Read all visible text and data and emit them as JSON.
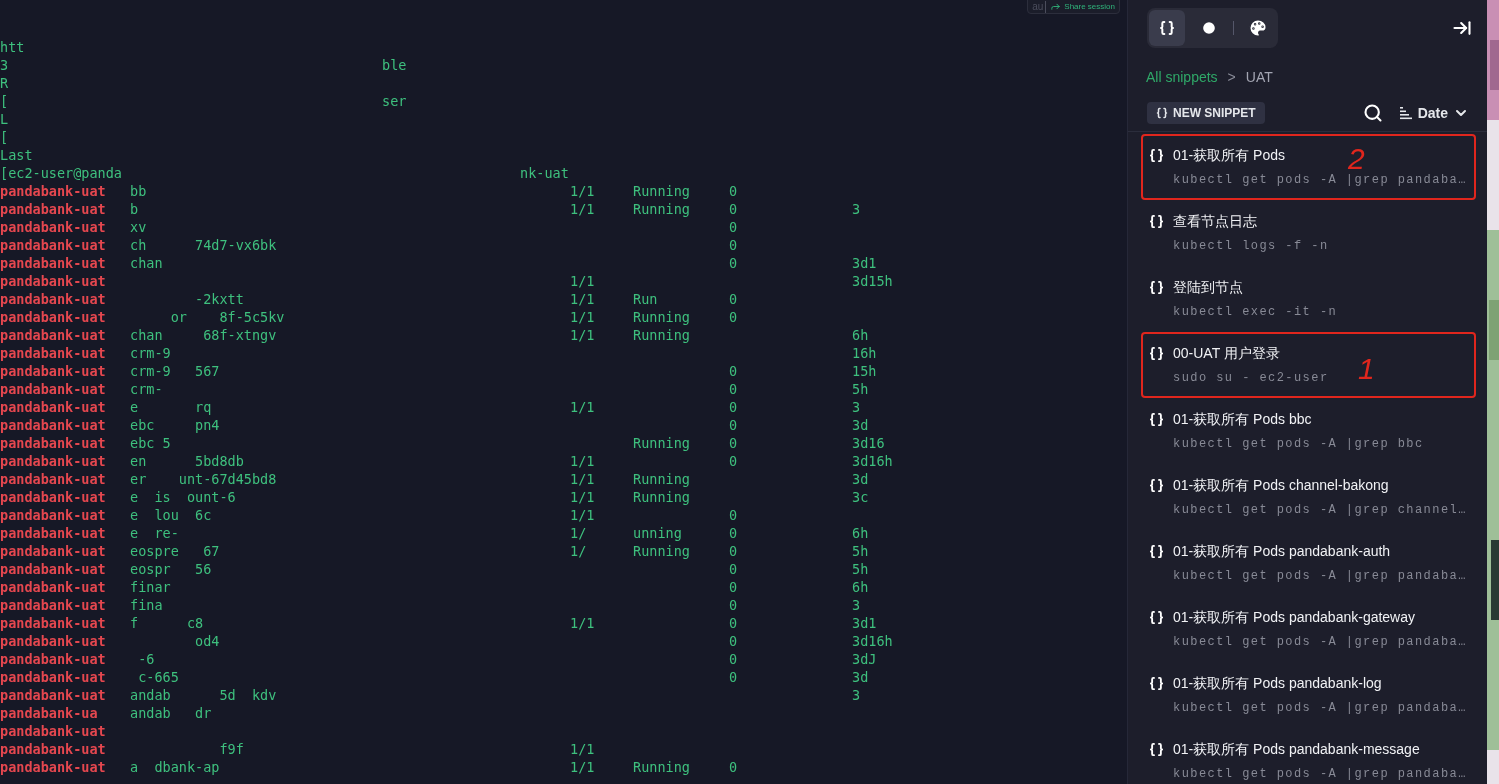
{
  "share_widget": {
    "label": "au",
    "button": "Share session"
  },
  "terminal": {
    "lines": [
      {
        "kind": "output",
        "text": "htt"
      },
      {
        "kind": "output",
        "text": "3",
        "tail": "ble"
      },
      {
        "kind": "output",
        "text": "R"
      },
      {
        "kind": "output",
        "text": "[",
        "tail": "ser"
      },
      {
        "kind": "output",
        "text": "L"
      },
      {
        "kind": "output",
        "text": "["
      },
      {
        "kind": "output",
        "text": "Last"
      },
      {
        "kind": "prompt",
        "text": "[ec2-user@panda",
        "tail": "nk-uat"
      }
    ],
    "rows": [
      {
        "namespace": "pandabank-uat",
        "name": "bb",
        "ready": "1/1",
        "status": "Running",
        "restarts": "0"
      },
      {
        "namespace": "pandabank-uat",
        "name": "b",
        "ready": "1/1",
        "status": "Running",
        "restarts": "0",
        "age": "3"
      },
      {
        "namespace": "pandabank-uat",
        "name": "xv",
        "restarts": "0"
      },
      {
        "namespace": "pandabank-uat",
        "name": "ch      74d7-vx6bk",
        "restarts": "0"
      },
      {
        "namespace": "pandabank-uat",
        "name": "chan",
        "restarts": "0",
        "age": "3d1"
      },
      {
        "namespace": "pandabank-uat",
        "ready": "1/1",
        "age": "3d15h"
      },
      {
        "namespace": "pandabank-uat",
        "name": "        -2kxtt",
        "ready": "1/1",
        "status": "Run",
        "restarts": "0"
      },
      {
        "namespace": "pandabank-uat",
        "name": "     or    8f-5c5kv",
        "ready": "1/1",
        "status": "Running",
        "restarts": "0"
      },
      {
        "namespace": "pandabank-uat",
        "name": "chan     68f-xtngv",
        "ready": "1/1",
        "status": "Running",
        "age": "6h"
      },
      {
        "namespace": "pandabank-uat",
        "name": "crm-9",
        "age": "16h"
      },
      {
        "namespace": "pandabank-uat",
        "name": "crm-9   567",
        "restarts": "0",
        "age": "15h"
      },
      {
        "namespace": "pandabank-uat",
        "name": "crm-",
        "restarts": "0",
        "age": "5h"
      },
      {
        "namespace": "pandabank-uat",
        "name": "e       rq",
        "ready": "1/1",
        "restarts": "0",
        "age": "3"
      },
      {
        "namespace": "pandabank-uat",
        "name": "ebc     pn4",
        "restarts": "0",
        "age": "3d"
      },
      {
        "namespace": "pandabank-uat",
        "name": "ebc 5",
        "status": "Running",
        "restarts": "0",
        "age": "3d16"
      },
      {
        "namespace": "pandabank-uat",
        "name": "en      5bd8db",
        "ready": "1/1",
        "restarts": "0",
        "age": "3d16h"
      },
      {
        "namespace": "pandabank-uat",
        "name": "er    unt-67d45bd8",
        "ready": "1/1",
        "status": "Running",
        "age": "3d"
      },
      {
        "namespace": "pandabank-uat",
        "name": "e  is  ount-6",
        "ready": "1/1",
        "status": "Running",
        "age": "3c"
      },
      {
        "namespace": "pandabank-uat",
        "name": "e  lou  6c",
        "ready": "1/1",
        "restarts": "0"
      },
      {
        "namespace": "pandabank-uat",
        "name": "e  re-",
        "ready": "1/",
        "status": "unning",
        "restarts": "0",
        "age": "6h"
      },
      {
        "namespace": "pandabank-uat",
        "name": "eospre   67",
        "ready": "1/",
        "status": "Running",
        "restarts": "0",
        "age": "5h"
      },
      {
        "namespace": "pandabank-uat",
        "name": "eospr   56",
        "restarts": "0",
        "age": "5h"
      },
      {
        "namespace": "pandabank-uat",
        "name": "finar",
        "restarts": "0",
        "age": "6h"
      },
      {
        "namespace": "pandabank-uat",
        "name": "fina",
        "restarts": "0",
        "age": "3"
      },
      {
        "namespace": "pandabank-uat",
        "name": "f      c8",
        "ready": "1/1",
        "restarts": "0",
        "age": "3d1"
      },
      {
        "namespace": "pandabank-uat",
        "name": "        od4",
        "restarts": "0",
        "age": "3d16h"
      },
      {
        "namespace": "pandabank-uat",
        "name": " -6",
        "restarts": "0",
        "age": "3dJ"
      },
      {
        "namespace": "pandabank-uat",
        "name": " c-665",
        "restarts": "0",
        "age": "3d"
      },
      {
        "namespace": "pandabank-uat",
        "name": "andab      5d  kdv",
        "age": "3"
      },
      {
        "namespace": "pandabank-ua",
        "name": "andab   dr"
      },
      {
        "namespace": "pandabank-uat"
      },
      {
        "namespace": "pandabank-uat",
        "name": "           f9f",
        "ready": "1/1"
      },
      {
        "namespace": "pandabank-uat",
        "name": "a  dbank-ap",
        "ready": "1/1",
        "status": "Running",
        "restarts": "0"
      }
    ]
  },
  "sidebar": {
    "tabs": [
      {
        "kind": "snippets",
        "selected": true
      },
      {
        "kind": "history",
        "selected": false
      },
      {
        "kind": "themes",
        "selected": false
      }
    ],
    "breadcrumb": {
      "root": "All snippets",
      "separator": ">",
      "current": "UAT"
    },
    "new_snippet": "NEW SNIPPET",
    "sort": "Date",
    "snippets": [
      {
        "title": "01-获取所有 Pods",
        "command": "kubectl get pods -A |grep pandaba…",
        "highlighted": true,
        "annotation": "2"
      },
      {
        "title": "查看节点日志",
        "command": "kubectl logs -f -n",
        "highlighted": false
      },
      {
        "title": "登陆到节点",
        "command": "kubectl exec -it -n",
        "highlighted": false
      },
      {
        "title": "00-UAT 用户登录",
        "command": "sudo su - ec2-user",
        "highlighted": true,
        "annotation": "1"
      },
      {
        "title": "01-获取所有 Pods bbc",
        "command": "kubectl get pods -A |grep bbc",
        "highlighted": false
      },
      {
        "title": "01-获取所有 Pods channel-bakong",
        "command": "kubectl get pods -A |grep channel…",
        "highlighted": false
      },
      {
        "title": "01-获取所有 Pods pandabank-auth",
        "command": "kubectl get pods -A |grep pandaba…",
        "highlighted": false
      },
      {
        "title": "01-获取所有 Pods pandabank-gateway",
        "command": "kubectl get pods -A |grep pandaba…",
        "highlighted": false
      },
      {
        "title": "01-获取所有 Pods pandabank-log",
        "command": "kubectl get pods -A |grep pandaba…",
        "highlighted": false
      },
      {
        "title": "01-获取所有 Pods pandabank-message",
        "command": "kubectl get pods -A |grep pandaba…",
        "highlighted": false
      }
    ]
  }
}
